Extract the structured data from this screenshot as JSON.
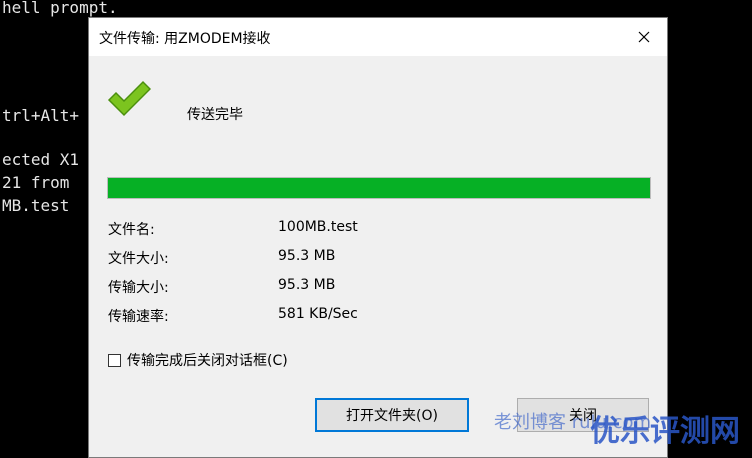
{
  "terminal": {
    "lines": [
      "hell prompt.",
      "trl+Alt+",
      "ected X1",
      "21 from",
      "MB.test"
    ]
  },
  "dialog": {
    "title": "文件传输: 用ZMODEM接收",
    "status": "传送完毕",
    "progress": 1.0,
    "info": [
      {
        "label": "文件名:",
        "value": "100MB.test"
      },
      {
        "label": "文件大小:",
        "value": "95.3 MB"
      },
      {
        "label": "传输大小:",
        "value": "95.3 MB"
      },
      {
        "label": "传输速率:",
        "value": "581 KB/Sec"
      }
    ],
    "checkbox_label": "传输完成后关闭对话框(C)",
    "checkbox_checked": false,
    "open_folder_button": "打开文件夹(O)",
    "close_button": "关闭"
  },
  "watermark": {
    "main": "优乐评测网",
    "small": "老刘博客 rulu.com"
  },
  "colors": {
    "progress_fill": "#06b025",
    "focus_border": "#0078d7"
  }
}
